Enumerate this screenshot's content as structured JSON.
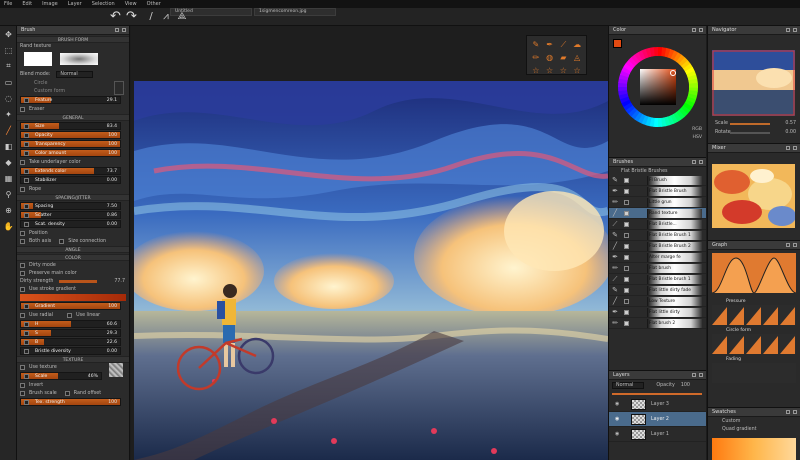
{
  "menu": [
    "File",
    "Edit",
    "Image",
    "Layer",
    "Selection",
    "View",
    "Other"
  ],
  "tabs": [
    "Untitled",
    "1sigmencomreon.jpg"
  ],
  "left_tools": [
    "move-icon",
    "select-icon",
    "crop-icon",
    "rect-select-icon",
    "lasso-icon",
    "wand-icon",
    "brush-icon",
    "eraser-icon",
    "bucket-icon",
    "gradient-icon",
    "eyedropper-icon",
    "zoom-icon",
    "hand-icon"
  ],
  "brush_panel": {
    "title": "Brush",
    "section_form": "BRUSH FORM",
    "texture_name": "Rand texture",
    "blend_label": "Blend mode:",
    "blend_value": "Normal",
    "circle": "Circle",
    "custom_form": "Custom form",
    "feature": "Feature",
    "feature_value": "29.1",
    "eraser": "Eraser",
    "section_general": "GENERAL",
    "general": [
      {
        "label": "Size",
        "value": "83.4",
        "fill": 0.38
      },
      {
        "label": "Opacity",
        "value": "100",
        "fill": 1.0
      },
      {
        "label": "Transparency",
        "value": "100",
        "fill": 1.0
      },
      {
        "label": "Color amount",
        "value": "100",
        "fill": 1.0
      }
    ],
    "take_underlayer": "Take underlayer color",
    "general2": [
      {
        "label": "Extends color",
        "value": "73.7",
        "fill": 0.74
      },
      {
        "label": "Stabilizer",
        "value": "0.00",
        "fill": 0.0
      }
    ],
    "rope": "Rope",
    "section_spacing": "SPACING/JITTER",
    "spacing": [
      {
        "label": "Spacing",
        "value": "7.50",
        "fill": 0.12
      },
      {
        "label": "Scatter",
        "value": "0.86",
        "fill": 0.2
      },
      {
        "label": "Scat. density",
        "value": "0.00",
        "fill": 0.0
      }
    ],
    "position": "Position",
    "both_axis": "Both axis",
    "size_connection": "Size connection",
    "section_angle": "ANGLE",
    "section_color": "COLOR",
    "dirty_mode": "Dirty mode",
    "preserve_main": "Preserve main color",
    "dirty_strength": "Dirty strength",
    "dirty_value": "77.7",
    "use_stroke_gradient": "Use stroke gradient",
    "gradient": "Gradient",
    "gradient_value": "100",
    "use_radial": "Use radial",
    "use_linear": "Use linear",
    "hsb": [
      {
        "label": "H",
        "value": "60.6",
        "fill": 0.5
      },
      {
        "label": "S",
        "value": "29.3",
        "fill": 0.3
      },
      {
        "label": "B",
        "value": "22.6",
        "fill": 0.23
      }
    ],
    "bristle": "Bristle diversity",
    "bristle_value": "0.00",
    "section_texture": "TEXTURE",
    "use_texture": "Use texture",
    "scale": "Scale",
    "scale_value": "46%",
    "invert": "Invert",
    "brush_scale": "Brush scale",
    "rand_offset": "Rand offset",
    "tex_strength": "Tex. strength",
    "tex_strength_value": "100"
  },
  "color_panel": {
    "title": "Color",
    "modes": [
      "RGB",
      "HSV"
    ],
    "current": "#e24a12"
  },
  "brushes_panel": {
    "title": "Brushes",
    "group": "Flat Bristle Brushes",
    "items": [
      "Fl Brush",
      "Flat Bristle Brush",
      "Little grun",
      "Rand texture",
      "Flat Bristle...",
      "Flat Bristle Brush 1",
      "Flat Bristle Brush 2",
      "Alter marge fe",
      "Flat brush",
      "Flat Bristle brush 1",
      "Flat little dirty fade",
      "Low Texture",
      "Flat little dirty",
      "Flat brush 2"
    ],
    "selected": 3
  },
  "layers_panel": {
    "title": "Layers",
    "blend": "Normal",
    "opacity": "Opacity",
    "opacity_value": "100",
    "items": [
      "Layer 3",
      "Layer 2",
      "Layer 1"
    ],
    "selected": 1
  },
  "navigator": {
    "title": "Navigator",
    "scale_label": "Scale",
    "scale_value": "0.57",
    "rotate_label": "Rotate",
    "rotate_value": "0.00"
  },
  "mixer": {
    "title": "Mixer"
  },
  "graph_panel": {
    "title": "Graph",
    "items": [
      "Pressure",
      "Circle form",
      "Fading"
    ]
  },
  "swatches": {
    "title": "Swatches",
    "items": [
      "Custom",
      "Quad gradient"
    ]
  }
}
